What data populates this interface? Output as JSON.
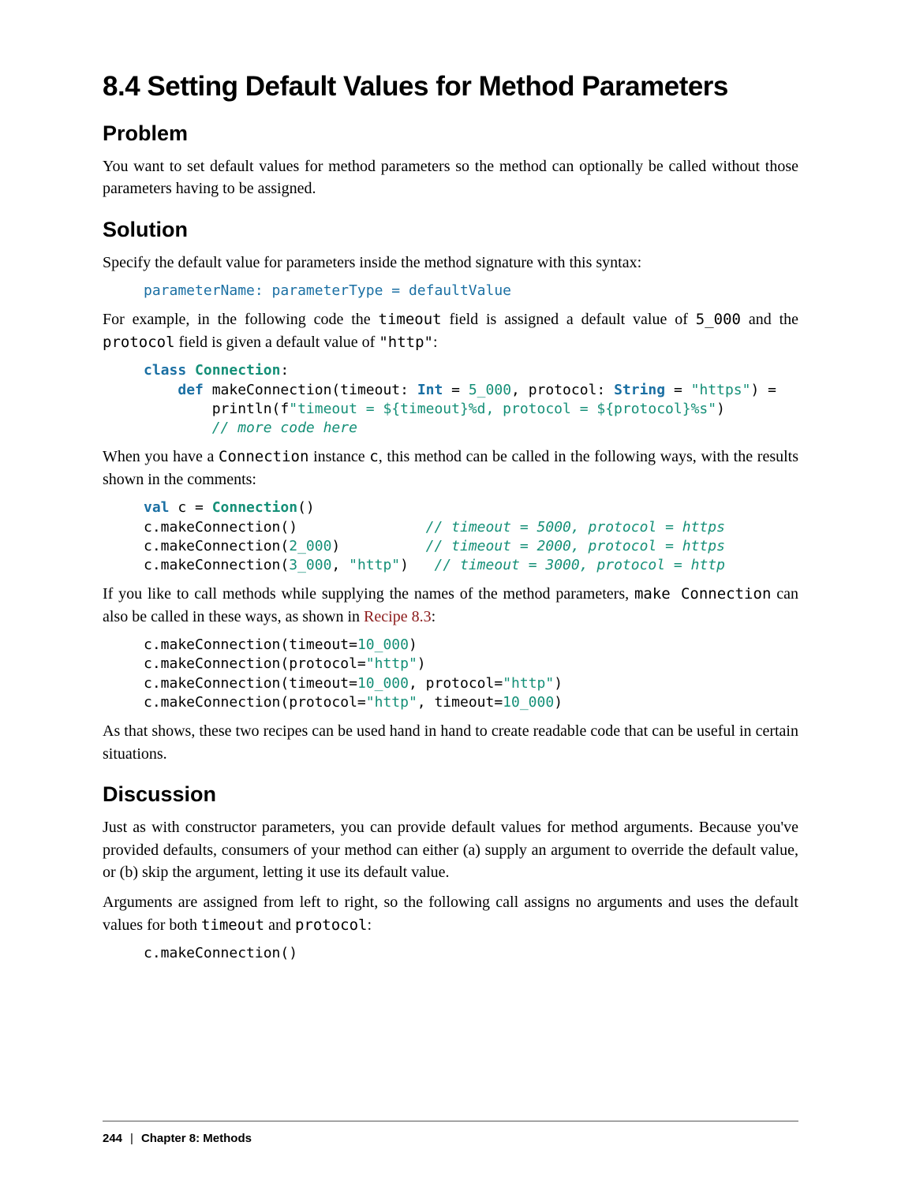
{
  "title": "8.4 Setting Default Values for Method Parameters",
  "sections": {
    "problem": {
      "heading": "Problem",
      "p1": "You want to set default values for method parameters so the method can optionally be called without those parameters having to be assigned."
    },
    "solution": {
      "heading": "Solution",
      "p1": "Specify the default value for parameters inside the method signature with this syntax:",
      "code1": "parameterName: parameterType = defaultValue",
      "p2a": "For example, in the following code the ",
      "p2code1": "timeout",
      "p2b": " field is assigned a default value of ",
      "p2code2": "5_000",
      "p2c": " and the ",
      "p2code3": "protocol",
      "p2d": " field is given a default value of ",
      "p2code4": "\"http\"",
      "p2e": ":",
      "code2": {
        "l1_kw": "class",
        "l1_name": "Connection",
        "l1_rest": ":",
        "l2_kw": "def",
        "l2_a": " makeConnection(timeout: ",
        "l2_ty1": "Int",
        "l2_b": " = ",
        "l2_n1": "5_000",
        "l2_c": ", protocol: ",
        "l2_ty2": "String",
        "l2_d": " = ",
        "l2_s1": "\"https\"",
        "l2_e": ") =",
        "l3_a": "        println(f",
        "l3_s": "\"timeout = ${timeout}%d, protocol = ${protocol}%s\"",
        "l3_b": ")",
        "l4_cmt": "        // more code here"
      },
      "p3a": "When you have a ",
      "p3code1": "Connection",
      "p3b": " instance ",
      "p3code2": "c",
      "p3c": ", this method can be called in the following ways, with the results shown in the comments:",
      "code3": {
        "l1_kw": "val",
        "l1_a": " c = ",
        "l1_id": "Connection",
        "l1_b": "()",
        "l2_a": "c.makeConnection()",
        "l2_cmt": "// timeout = 5000, protocol = https",
        "l3_a": "c.makeConnection(",
        "l3_n": "2_000",
        "l3_b": ")",
        "l3_cmt": "// timeout = 2000, protocol = https",
        "l4_a": "c.makeConnection(",
        "l4_n": "3_000",
        "l4_b": ", ",
        "l4_s": "\"http\"",
        "l4_c": ")",
        "l4_cmt": "// timeout = 3000, protocol = http"
      },
      "p4a": "If you like to call methods while supplying the names of the method parameters, ",
      "p4code1": "make Connection",
      "p4b": " can also be called in these ways, as shown in ",
      "p4link": "Recipe 8.3",
      "p4c": ":",
      "code4": {
        "l1a": "c.makeConnection(timeout=",
        "l1n": "10_000",
        "l1b": ")",
        "l2a": "c.makeConnection(protocol=",
        "l2s": "\"http\"",
        "l2b": ")",
        "l3a": "c.makeConnection(timeout=",
        "l3n": "10_000",
        "l3b": ", protocol=",
        "l3s": "\"http\"",
        "l3c": ")",
        "l4a": "c.makeConnection(protocol=",
        "l4s": "\"http\"",
        "l4b": ", timeout=",
        "l4n": "10_000",
        "l4c": ")"
      },
      "p5": "As that shows, these two recipes can be used hand in hand to create readable code that can be useful in certain situations."
    },
    "discussion": {
      "heading": "Discussion",
      "p1": "Just as with constructor parameters, you can provide default values for method arguments. Because you've provided defaults, consumers of your method can either (a) supply an argument to override the default value, or (b) skip the argument, letting it use its default value.",
      "p2a": "Arguments are assigned from left to right, so the following call assigns no arguments and uses the default values for both ",
      "p2code1": "timeout",
      "p2b": " and ",
      "p2code2": "protocol",
      "p2c": ":",
      "code1": "c.makeConnection()"
    }
  },
  "footer": {
    "page": "244",
    "chapter": "Chapter 8: Methods"
  }
}
